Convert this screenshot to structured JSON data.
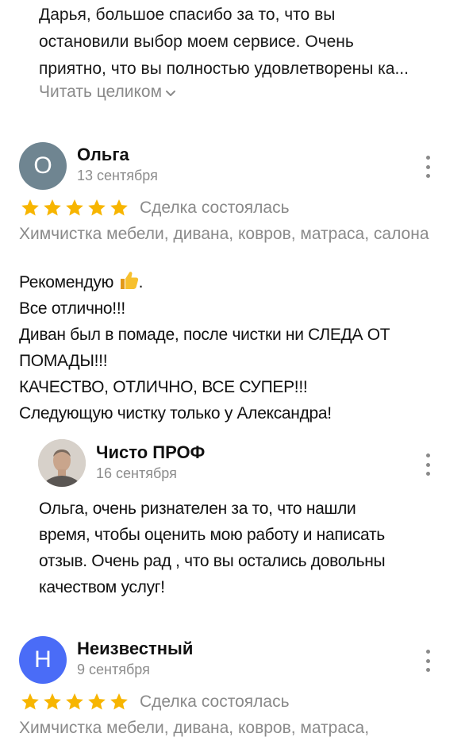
{
  "top_reply": {
    "lines": [
      "Дарья, большое спасибо за то, что вы",
      "остановили выбор моем сервисе. Очень",
      "приятно, что вы полностью удовлетворены ка..."
    ],
    "read_more_label": "Читать целиком"
  },
  "reviews": [
    {
      "avatar_letter": "О",
      "avatar_color": "#6f8591",
      "author": "Ольга",
      "date": "13 сентября",
      "rating": 5,
      "deal_status": "Сделка состоялась",
      "service": "Химчистка мебели, дивана, ковров, матраса, салона",
      "body_lines": [
        "Рекомендую",
        "Все отлично!!!",
        "Диван был в помаде, после чистки ни СЛЕДА ОТ",
        "ПОМАДЫ!!!",
        "КАЧЕСТВО, ОТЛИЧНО, ВСЕ СУПЕР!!!",
        "Следующую чистку только у  Александра!"
      ],
      "body_suffix": ".",
      "reply": {
        "author": "Чисто ПРОФ",
        "date": "16 сентября",
        "lines": [
          "Ольга, очень ризнателен за то, что нашли",
          "время, чтобы оценить мою работу и написать",
          "отзыв. Очень рад , что вы остались довольны",
          "качеством услуг!"
        ]
      }
    },
    {
      "avatar_letter": "Н",
      "avatar_color": "#4a6cf7",
      "author": "Неизвестный",
      "date": "9 сентября",
      "rating": 5,
      "deal_status": "Сделка состоялась",
      "service": "Химчистка мебели, дивана, ковров, матраса,"
    }
  ],
  "colors": {
    "star": "#f7b500",
    "muted_text": "#8a8a8a"
  },
  "icons": {
    "more": "more-vertical-icon",
    "chevron": "chevron-down-icon",
    "thumb": "thumbs-up-emoji",
    "star": "star-icon"
  }
}
